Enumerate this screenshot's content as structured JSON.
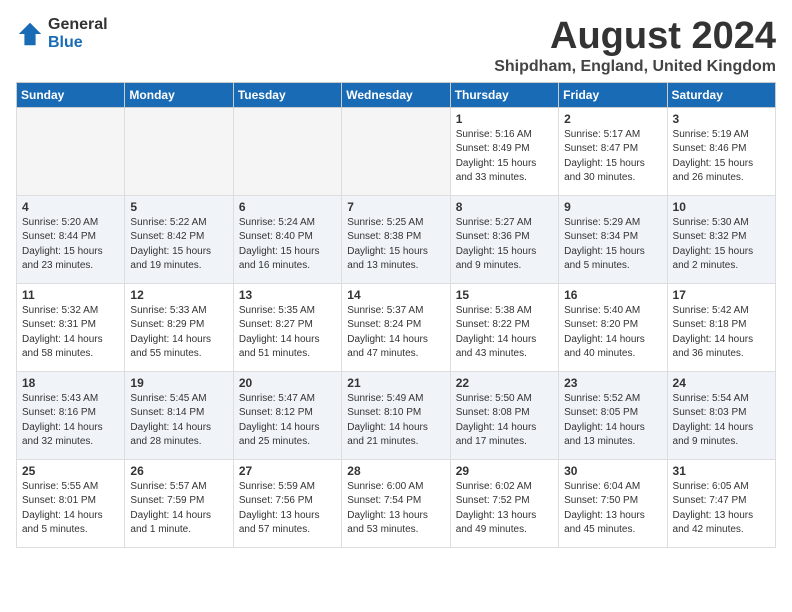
{
  "logo": {
    "general": "General",
    "blue": "Blue"
  },
  "title": "August 2024",
  "location": "Shipdham, England, United Kingdom",
  "headers": [
    "Sunday",
    "Monday",
    "Tuesday",
    "Wednesday",
    "Thursday",
    "Friday",
    "Saturday"
  ],
  "weeks": [
    [
      {
        "day": "",
        "info": ""
      },
      {
        "day": "",
        "info": ""
      },
      {
        "day": "",
        "info": ""
      },
      {
        "day": "",
        "info": ""
      },
      {
        "day": "1",
        "info": "Sunrise: 5:16 AM\nSunset: 8:49 PM\nDaylight: 15 hours\nand 33 minutes."
      },
      {
        "day": "2",
        "info": "Sunrise: 5:17 AM\nSunset: 8:47 PM\nDaylight: 15 hours\nand 30 minutes."
      },
      {
        "day": "3",
        "info": "Sunrise: 5:19 AM\nSunset: 8:46 PM\nDaylight: 15 hours\nand 26 minutes."
      }
    ],
    [
      {
        "day": "4",
        "info": "Sunrise: 5:20 AM\nSunset: 8:44 PM\nDaylight: 15 hours\nand 23 minutes."
      },
      {
        "day": "5",
        "info": "Sunrise: 5:22 AM\nSunset: 8:42 PM\nDaylight: 15 hours\nand 19 minutes."
      },
      {
        "day": "6",
        "info": "Sunrise: 5:24 AM\nSunset: 8:40 PM\nDaylight: 15 hours\nand 16 minutes."
      },
      {
        "day": "7",
        "info": "Sunrise: 5:25 AM\nSunset: 8:38 PM\nDaylight: 15 hours\nand 13 minutes."
      },
      {
        "day": "8",
        "info": "Sunrise: 5:27 AM\nSunset: 8:36 PM\nDaylight: 15 hours\nand 9 minutes."
      },
      {
        "day": "9",
        "info": "Sunrise: 5:29 AM\nSunset: 8:34 PM\nDaylight: 15 hours\nand 5 minutes."
      },
      {
        "day": "10",
        "info": "Sunrise: 5:30 AM\nSunset: 8:32 PM\nDaylight: 15 hours\nand 2 minutes."
      }
    ],
    [
      {
        "day": "11",
        "info": "Sunrise: 5:32 AM\nSunset: 8:31 PM\nDaylight: 14 hours\nand 58 minutes."
      },
      {
        "day": "12",
        "info": "Sunrise: 5:33 AM\nSunset: 8:29 PM\nDaylight: 14 hours\nand 55 minutes."
      },
      {
        "day": "13",
        "info": "Sunrise: 5:35 AM\nSunset: 8:27 PM\nDaylight: 14 hours\nand 51 minutes."
      },
      {
        "day": "14",
        "info": "Sunrise: 5:37 AM\nSunset: 8:24 PM\nDaylight: 14 hours\nand 47 minutes."
      },
      {
        "day": "15",
        "info": "Sunrise: 5:38 AM\nSunset: 8:22 PM\nDaylight: 14 hours\nand 43 minutes."
      },
      {
        "day": "16",
        "info": "Sunrise: 5:40 AM\nSunset: 8:20 PM\nDaylight: 14 hours\nand 40 minutes."
      },
      {
        "day": "17",
        "info": "Sunrise: 5:42 AM\nSunset: 8:18 PM\nDaylight: 14 hours\nand 36 minutes."
      }
    ],
    [
      {
        "day": "18",
        "info": "Sunrise: 5:43 AM\nSunset: 8:16 PM\nDaylight: 14 hours\nand 32 minutes."
      },
      {
        "day": "19",
        "info": "Sunrise: 5:45 AM\nSunset: 8:14 PM\nDaylight: 14 hours\nand 28 minutes."
      },
      {
        "day": "20",
        "info": "Sunrise: 5:47 AM\nSunset: 8:12 PM\nDaylight: 14 hours\nand 25 minutes."
      },
      {
        "day": "21",
        "info": "Sunrise: 5:49 AM\nSunset: 8:10 PM\nDaylight: 14 hours\nand 21 minutes."
      },
      {
        "day": "22",
        "info": "Sunrise: 5:50 AM\nSunset: 8:08 PM\nDaylight: 14 hours\nand 17 minutes."
      },
      {
        "day": "23",
        "info": "Sunrise: 5:52 AM\nSunset: 8:05 PM\nDaylight: 14 hours\nand 13 minutes."
      },
      {
        "day": "24",
        "info": "Sunrise: 5:54 AM\nSunset: 8:03 PM\nDaylight: 14 hours\nand 9 minutes."
      }
    ],
    [
      {
        "day": "25",
        "info": "Sunrise: 5:55 AM\nSunset: 8:01 PM\nDaylight: 14 hours\nand 5 minutes."
      },
      {
        "day": "26",
        "info": "Sunrise: 5:57 AM\nSunset: 7:59 PM\nDaylight: 14 hours\nand 1 minute."
      },
      {
        "day": "27",
        "info": "Sunrise: 5:59 AM\nSunset: 7:56 PM\nDaylight: 13 hours\nand 57 minutes."
      },
      {
        "day": "28",
        "info": "Sunrise: 6:00 AM\nSunset: 7:54 PM\nDaylight: 13 hours\nand 53 minutes."
      },
      {
        "day": "29",
        "info": "Sunrise: 6:02 AM\nSunset: 7:52 PM\nDaylight: 13 hours\nand 49 minutes."
      },
      {
        "day": "30",
        "info": "Sunrise: 6:04 AM\nSunset: 7:50 PM\nDaylight: 13 hours\nand 45 minutes."
      },
      {
        "day": "31",
        "info": "Sunrise: 6:05 AM\nSunset: 7:47 PM\nDaylight: 13 hours\nand 42 minutes."
      }
    ]
  ]
}
